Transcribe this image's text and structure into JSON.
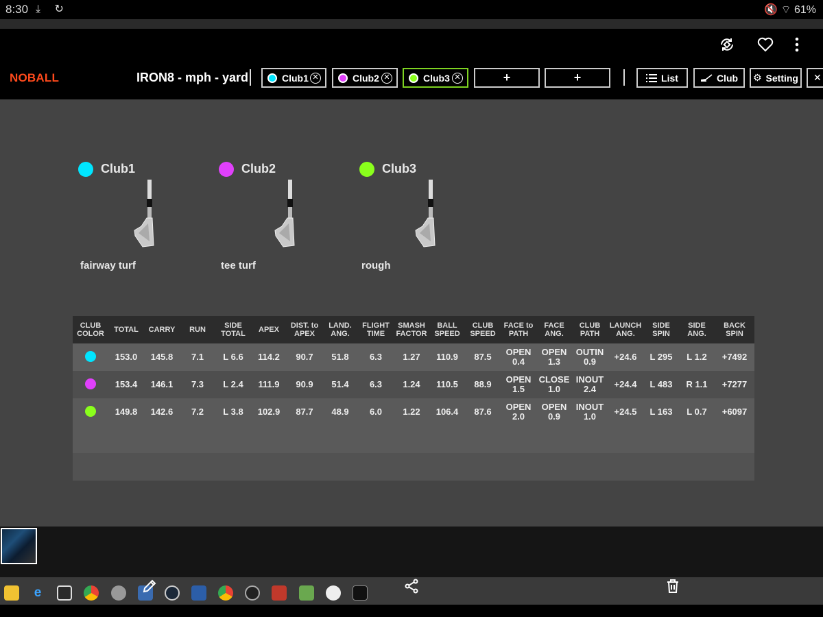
{
  "status_bar": {
    "time": "8:30",
    "battery": "61%"
  },
  "header": {
    "brand": "NOBALL",
    "title": "IRON8 - mph - yard",
    "clubs": [
      {
        "label": "Club1",
        "color": "#00e5ff",
        "active": false
      },
      {
        "label": "Club2",
        "color": "#e040fb",
        "active": false
      },
      {
        "label": "Club3",
        "color": "#8aff1c",
        "active": true
      }
    ],
    "add_label": "+",
    "buttons": {
      "list": "List",
      "club": "Club",
      "setting": "Setting"
    }
  },
  "club_cards": [
    {
      "name": "Club1",
      "turf": "fairway turf",
      "color": "#00e5ff"
    },
    {
      "name": "Club2",
      "turf": "tee turf",
      "color": "#e040fb"
    },
    {
      "name": "Club3",
      "turf": "rough",
      "color": "#8aff1c"
    }
  ],
  "table": {
    "headers": [
      [
        "CLUB",
        "COLOR"
      ],
      [
        "TOTAL"
      ],
      [
        "CARRY"
      ],
      [
        "RUN"
      ],
      [
        "SIDE",
        "TOTAL"
      ],
      [
        "APEX"
      ],
      [
        "DIST. to",
        "APEX"
      ],
      [
        "LAND.",
        "ANG."
      ],
      [
        "FLIGHT",
        "TIME"
      ],
      [
        "SMASH",
        "FACTOR"
      ],
      [
        "BALL",
        "SPEED"
      ],
      [
        "CLUB",
        "SPEED"
      ],
      [
        "FACE to",
        "PATH"
      ],
      [
        "FACE",
        "ANG."
      ],
      [
        "CLUB",
        "PATH"
      ],
      [
        "LAUNCH",
        "ANG."
      ],
      [
        "SIDE",
        "SPIN"
      ],
      [
        "SIDE",
        "ANG."
      ],
      [
        "BACK",
        "SPIN"
      ]
    ],
    "rows": [
      {
        "color": "#00e5ff",
        "cells": [
          "153.0",
          "145.8",
          "7.1",
          "L 6.6",
          "114.2",
          "90.7",
          "51.8",
          "6.3",
          "1.27",
          "110.9",
          "87.5",
          [
            "OPEN",
            "0.4"
          ],
          [
            "OPEN",
            "1.3"
          ],
          [
            "OUTIN",
            "0.9"
          ],
          "+24.6",
          "L 295",
          "L 1.2",
          "+7492"
        ]
      },
      {
        "color": "#e040fb",
        "cells": [
          "153.4",
          "146.1",
          "7.3",
          "L 2.4",
          "111.9",
          "90.9",
          "51.4",
          "6.3",
          "1.24",
          "110.5",
          "88.9",
          [
            "OPEN",
            "1.5"
          ],
          [
            "CLOSE",
            "1.0"
          ],
          [
            "INOUT",
            "2.4"
          ],
          "+24.4",
          "L 483",
          "R 1.1",
          "+7277"
        ]
      },
      {
        "color": "#8aff1c",
        "cells": [
          "149.8",
          "142.6",
          "7.2",
          "L 3.8",
          "102.9",
          "87.7",
          "48.9",
          "6.0",
          "1.22",
          "106.4",
          "87.6",
          [
            "OPEN",
            "2.0"
          ],
          [
            "OPEN",
            "0.9"
          ],
          [
            "INOUT",
            "1.0"
          ],
          "+24.5",
          "L 163",
          "L 0.7",
          "+6097"
        ]
      }
    ]
  }
}
